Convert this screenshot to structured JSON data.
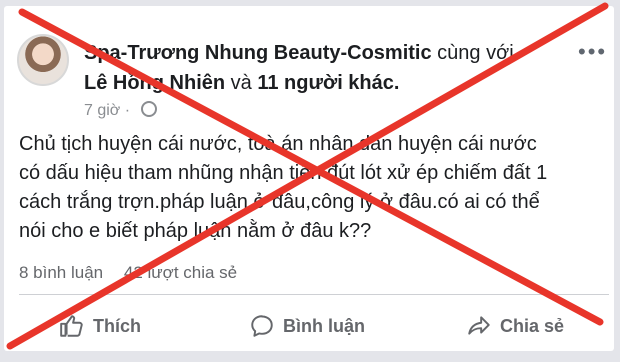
{
  "post": {
    "author": "Spa-Trương Nhung Beauty-Cosmitic",
    "with_text": "cùng với",
    "tagged_person": "Lê Hồng Nhiên",
    "and_text": "và",
    "others": "11 người khác.",
    "time": "7 giờ",
    "privacy_icon": "globe-icon",
    "text_lines": [
      "Chủ tịch huyện cái nước, toà án nhân dân huyện cái nước",
      "có dấu hiệu tham nhũng nhận tiền đút lót xử ép chiếm đất 1",
      "cách trắng trợn.pháp luận ở đâu,công lý ở đâu.có ai có thể",
      "nói cho e biết pháp luận nằm ở đâu k??"
    ],
    "comments": "8 bình luận",
    "shares": "42 lượt chia sẻ"
  },
  "actions": {
    "like": "Thích",
    "comment": "Bình luận",
    "share": "Chia sẻ"
  },
  "overlay": {
    "cross_color": "#e8352a"
  }
}
